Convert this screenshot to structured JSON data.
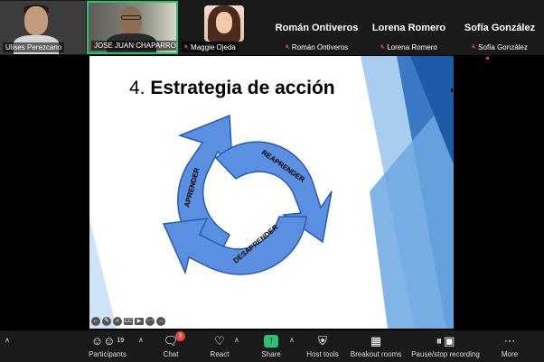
{
  "participants": [
    {
      "name": "Ulises Perezcano",
      "muted": false
    },
    {
      "name": "JOSE JUAN CHAPARRO",
      "muted": false
    },
    {
      "name": "Maggie Ojeda",
      "muted": true
    },
    {
      "name": "Román Ontiveros",
      "muted": true,
      "display": "Román Ontiveros"
    },
    {
      "name": "Lorena Romero",
      "muted": true,
      "display": "Lorena Romero"
    },
    {
      "name": "Sofía González",
      "muted": true,
      "display": "Sofía González"
    }
  ],
  "slide": {
    "number": "4.",
    "title": "Estrategia de acción",
    "cycle_labels": [
      "APRENDER",
      "REAPRENDER",
      "DESAPRENDER"
    ]
  },
  "toolbar": {
    "participants": {
      "label": "Participants",
      "count": "19"
    },
    "chat": {
      "label": "Chat",
      "badge": "3"
    },
    "react": {
      "label": "React"
    },
    "share": {
      "label": "Share"
    },
    "host_tools": {
      "label": "Host tools"
    },
    "breakout": {
      "label": "Breakout rooms"
    },
    "recording": {
      "label": "Pause/stop recording"
    },
    "more": {
      "label": "More"
    }
  },
  "colors": {
    "active_speaker": "#2fbf71",
    "arrow_fill": "#5b8fe0",
    "arrow_stroke": "#2a5ab0",
    "share_green": "#2fbf71",
    "mute_red": "#e0443c"
  }
}
